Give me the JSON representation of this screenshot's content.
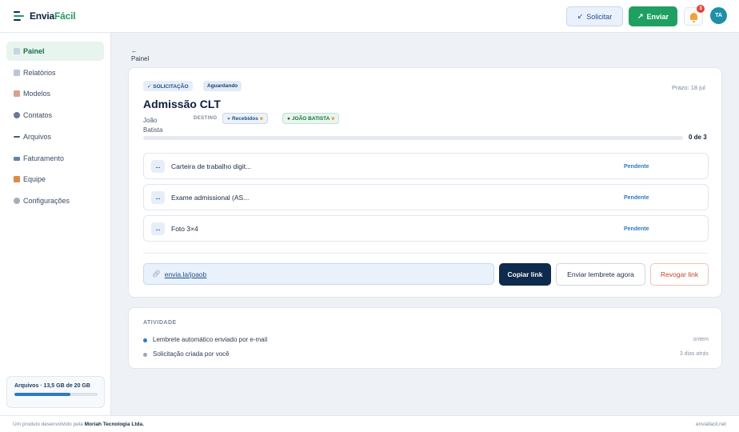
{
  "header": {
    "logo_text_a": "Envia",
    "logo_text_b": "Fácil",
    "solicitar_label": "Solicitar",
    "enviar_label": "Enviar",
    "notification_count": "3",
    "avatar_initials": "TA",
    "colors": {
      "primary_green": "#1fa062",
      "navy": "#0e2a4d",
      "accent_blue": "#2f78c4"
    }
  },
  "sidebar": {
    "items": [
      {
        "label": "Painel",
        "icon": "dashboard-icon",
        "active": true
      },
      {
        "label": "Relatórios",
        "icon": "chart-icon"
      },
      {
        "label": "Modelos",
        "icon": "template-icon"
      },
      {
        "label": "Contatos",
        "icon": "people-icon"
      },
      {
        "label": "Arquivos",
        "icon": "files-icon"
      },
      {
        "label": "Faturamento",
        "icon": "billing-icon"
      },
      {
        "label": "Equipe",
        "icon": "team-icon"
      },
      {
        "label": "Configurações",
        "icon": "gear-icon"
      }
    ],
    "storage": {
      "label": "Arquivos · 13,5 GB de 20 GB",
      "used_fraction": 0.675
    }
  },
  "main": {
    "back_arrow": "←",
    "back_label": "Painel",
    "request": {
      "type_chip": "✓ SOLICITAÇÃO",
      "status_chip": "Aguardando",
      "deadline": "Prazo: 18 jul",
      "title": "Admissão CLT",
      "recipient": "João Batista",
      "destination_label": "DESTINO",
      "destination_folder": "Recebidos",
      "destination_person": "JOÃO BATISTA",
      "progress_text": "0 de 3",
      "progress_fraction": 0.0
    },
    "documents": [
      {
        "icon_text": "...",
        "name": "Carteira de trabalho digit...",
        "status": "Pendente"
      },
      {
        "icon_text": "...",
        "name": "Exame admissional (AS...",
        "status": "Pendente"
      },
      {
        "icon_text": "...",
        "name": "Foto 3×4",
        "status": "Pendente"
      }
    ],
    "share": {
      "link": "envia.la/joaob",
      "copy_label": "Copiar link",
      "remind_label": "Enviar lembrete agora",
      "revoke_label": "Revogar link"
    },
    "activity": {
      "title": "ATIVIDADE",
      "items": [
        {
          "text": "Lembrete automático enviado por e-mail",
          "time": "ontem",
          "dot_color": "#2f78c4"
        },
        {
          "text": "Solicitação criada por você",
          "time": "3 dias atrás",
          "dot_color": "#9aa5b5"
        }
      ]
    }
  },
  "footer": {
    "left_prefix": "Um produto desenvolvido pela ",
    "left_company": "Moriah Tecnologia Ltda.",
    "right": "enviafacil.net"
  }
}
